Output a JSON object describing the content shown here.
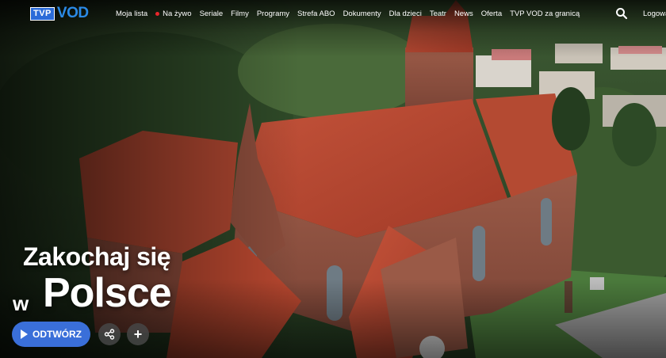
{
  "brand": {
    "logo_box": "TVP",
    "logo_word": "VOD"
  },
  "nav": {
    "items": [
      {
        "label": "Moja lista"
      },
      {
        "label": "Na żywo",
        "live": true
      },
      {
        "label": "Seriale"
      },
      {
        "label": "Filmy"
      },
      {
        "label": "Programy"
      },
      {
        "label": "Strefa ABO"
      },
      {
        "label": "Dokumenty"
      },
      {
        "label": "Dla dzieci"
      },
      {
        "label": "Teatr"
      },
      {
        "label": "News"
      },
      {
        "label": "Oferta"
      },
      {
        "label": "TVP VOD za granicą"
      }
    ],
    "search_icon": "search-icon",
    "login_label": "Logowa"
  },
  "hero": {
    "title_line1": "Zakochaj się",
    "title_line2_prefix": "w",
    "title_line2": "Polsce",
    "play_label": "ODTWÓRZ",
    "share_icon": "share-icon",
    "add_icon": "plus-icon",
    "add_glyph": "+"
  },
  "colors": {
    "accent": "#3a6fd9",
    "live": "#e8262b",
    "brand_blue": "#2b8ae6"
  }
}
